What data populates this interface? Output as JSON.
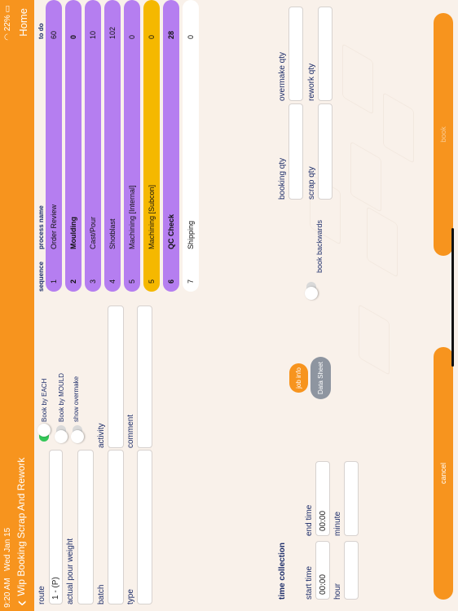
{
  "status": {
    "time": "9:20 AM",
    "date": "Wed Jan 15",
    "battery": "22%"
  },
  "nav": {
    "back_label": "Wip Booking Scrap And Rework",
    "home_label": "Home"
  },
  "form": {
    "route_label": "route",
    "route_value": "1 - (P)",
    "actual_pour_weight_label": "actual pour weight",
    "batch_label": "batch",
    "type_label": "type",
    "activity_label": "activity",
    "comment_label": "comment"
  },
  "toggles": {
    "book_by_each": "Book by EACH",
    "book_by_mould": "Book by MOULD",
    "show_overmake": "show overmake"
  },
  "buttons": {
    "job_info": "job info",
    "data_sheet": "Data Sheet",
    "cancel": "cancel",
    "book": "book"
  },
  "time_collection": {
    "title": "time collection",
    "start_time_label": "start time",
    "start_time_value": "00:00",
    "end_time_label": "end time",
    "end_time_value": "00:00",
    "hour_label": "hour",
    "minute_label": "minute"
  },
  "table": {
    "headers": {
      "sequence": "sequence",
      "process_name": "process name",
      "to_do": "to do"
    },
    "rows": [
      {
        "seq": "1",
        "name": "Order Review",
        "todo": "60",
        "color": "#b57ef0",
        "bold": false
      },
      {
        "seq": "2",
        "name": "Moulding",
        "todo": "0",
        "color": "#b57ef0",
        "bold": true
      },
      {
        "seq": "3",
        "name": "Cast/Pour",
        "todo": "10",
        "color": "#b57ef0",
        "bold": false
      },
      {
        "seq": "4",
        "name": "Shotblast",
        "todo": "102",
        "color": "#b57ef0",
        "bold": false
      },
      {
        "seq": "5",
        "name": "Machining [Internal]",
        "todo": "0",
        "color": "#b57ef0",
        "bold": false
      },
      {
        "seq": "5",
        "name": "Machining [Subcon]",
        "todo": "0",
        "color": "#f5b800",
        "bold": false
      },
      {
        "seq": "6",
        "name": "QC Check",
        "todo": "28",
        "color": "#b57ef0",
        "bold": true
      },
      {
        "seq": "7",
        "name": "Shipping",
        "todo": "0",
        "color": "#ffffff",
        "bold": false
      }
    ]
  },
  "qty": {
    "booking_qty": "booking qty",
    "overmake_qty": "overmake qty",
    "scrap_qty": "scrap qty",
    "rework_qty": "rework qty",
    "book_backwards": "book backwards"
  },
  "colors": {
    "accent": "#f7941e",
    "purple": "#b57ef0",
    "yellow": "#f5b800",
    "label": "#1f2f6b"
  }
}
